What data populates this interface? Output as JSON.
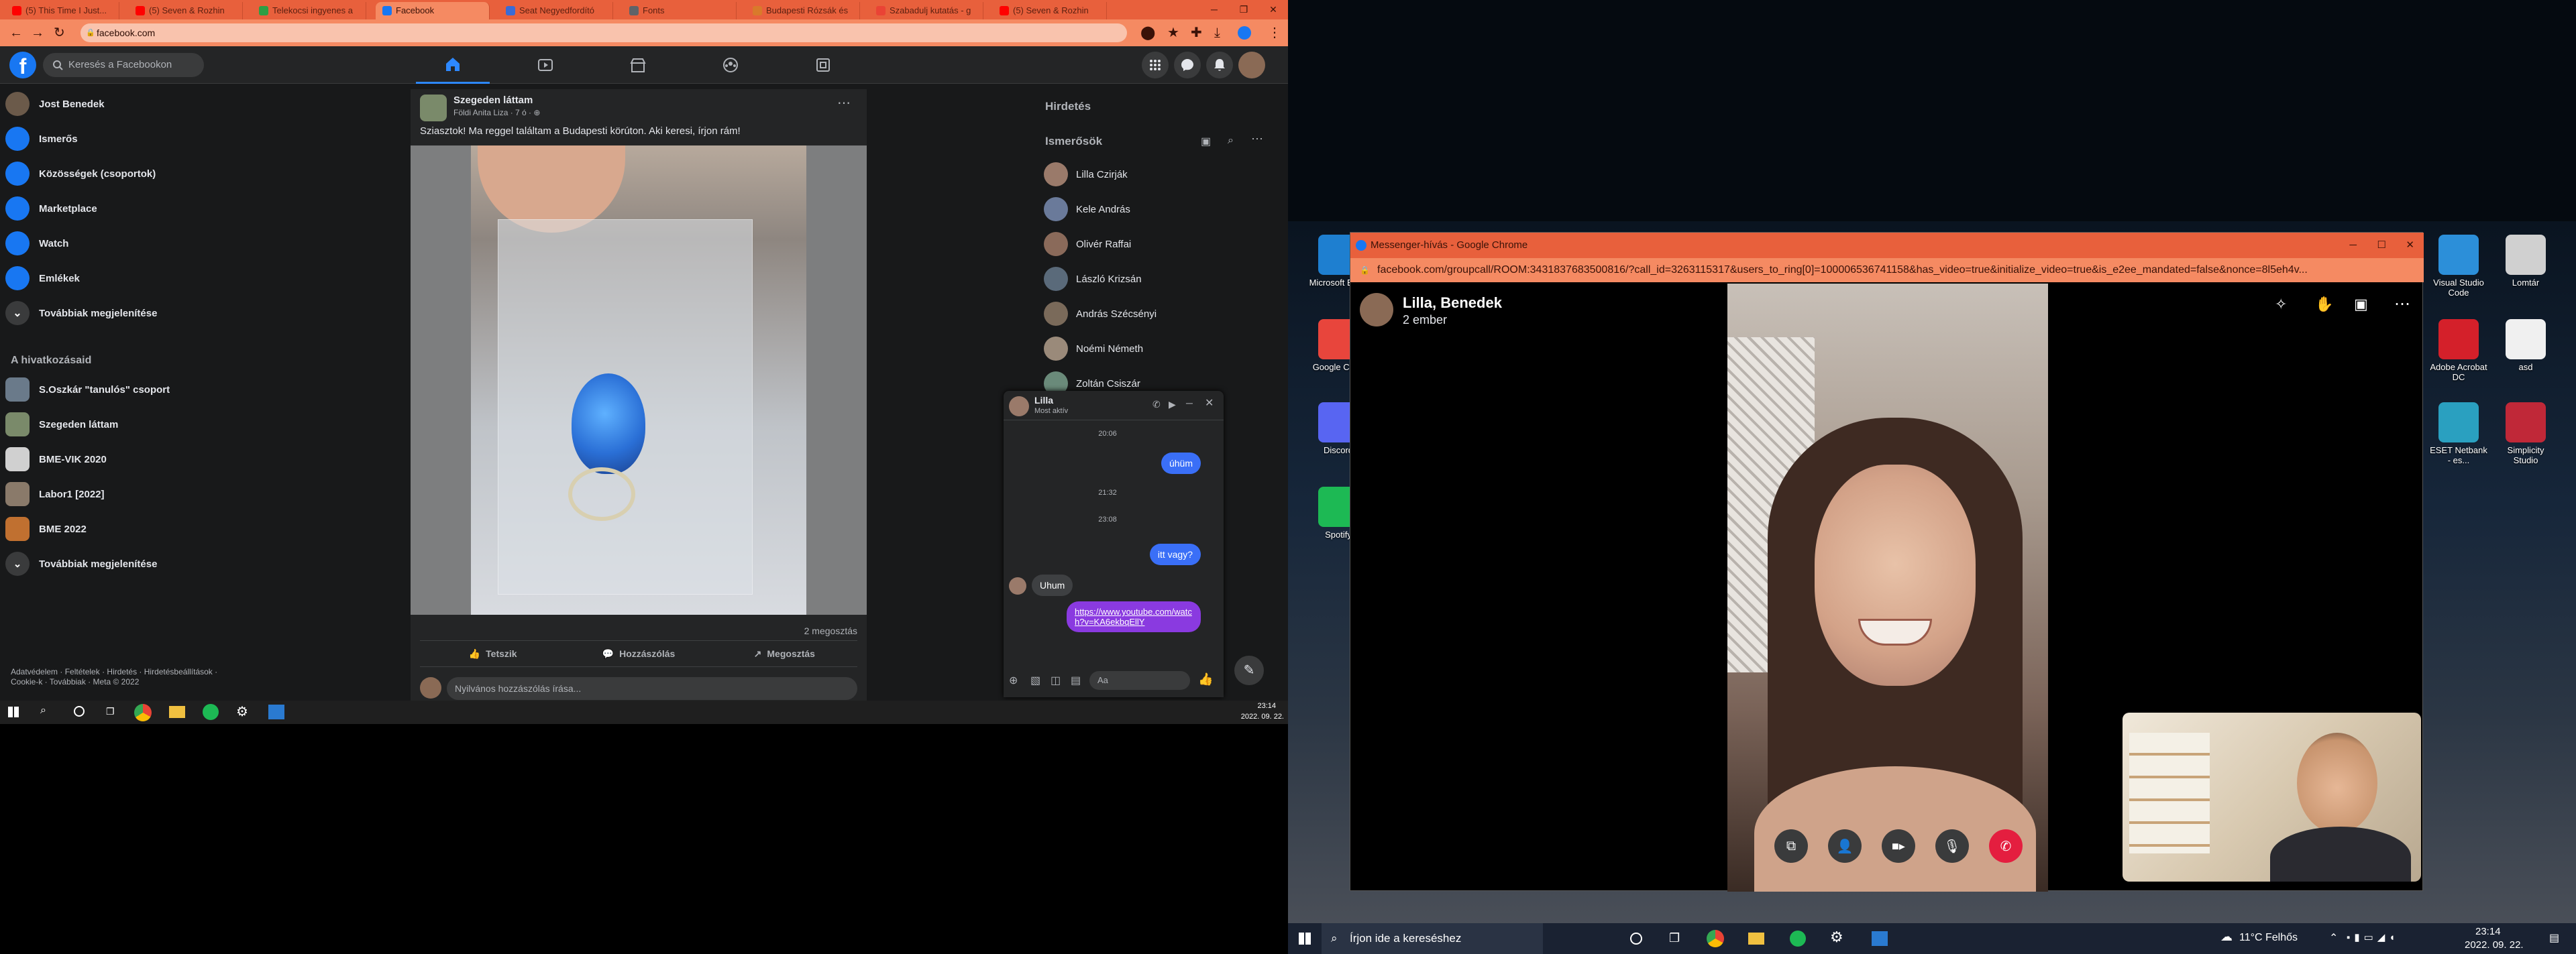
{
  "browser": {
    "tabs": [
      {
        "label": "(5) This Time I Just...",
        "color": "#ff0000"
      },
      {
        "label": "(5) Seven & Rozhin",
        "color": "#ff0000"
      },
      {
        "label": "Telekocsi ingyenes a",
        "color": "#2e9e44"
      },
      {
        "label": "Facebook",
        "color": "#1877f2"
      },
      {
        "label": "Seat Negyedfordító",
        "color": "#3a6bd6"
      },
      {
        "label": "Fonts",
        "color": "#5f6368"
      },
      {
        "label": "Budapesti Rózsák és",
        "color": "#d97a2b"
      },
      {
        "label": "Szabadulj kutatás - g",
        "color": "#ea4335"
      },
      {
        "label": "(5) Seven & Rozhin",
        "color": "#ff0000"
      }
    ],
    "url": "facebook.com"
  },
  "fb": {
    "search_placeholder": "Keresés a Facebookon",
    "nav": [
      {
        "label": "Jost Benedek",
        "icon": "avatar",
        "color": "#6b5a4a"
      },
      {
        "label": "Ismerős",
        "icon": "friends-icon",
        "color": "#1877f2"
      },
      {
        "label": "Közösségek (csoportok)",
        "icon": "groups-icon",
        "color": "#1877f2"
      },
      {
        "label": "Marketplace",
        "icon": "marketplace-icon",
        "color": "#1877f2"
      },
      {
        "label": "Watch",
        "icon": "watch-icon",
        "color": "#1877f2"
      },
      {
        "label": "Emlékek",
        "icon": "memories-icon",
        "color": "#1877f2"
      },
      {
        "label": "Továbbiak megjelenítése",
        "icon": "chevron-down-icon",
        "color": "#3a3b3c"
      }
    ],
    "shortcuts_title": "A hivatkozásaid",
    "shortcuts": [
      {
        "label": "S.Oszkár \"tanulós\" csoport",
        "color": "#6a7a8a"
      },
      {
        "label": "Szegeden láttam",
        "color": "#7a8a6a"
      },
      {
        "label": "BME-VIK 2020",
        "color": "#d0d0d0"
      },
      {
        "label": "Labor1 [2022]",
        "color": "#8a7a6a"
      },
      {
        "label": "BME 2022",
        "color": "#c07030"
      },
      {
        "label": "Továbbiak megjelenítése",
        "color": "#3a3b3c"
      }
    ],
    "footer": "Adatvédelem · Feltételek · Hirdetés · Hirdetésbeállítások · Cookie-k · Továbbiak · Meta © 2022",
    "post": {
      "group": "Szegeden láttam",
      "meta": "Földi Anita Liza · 7 ó · ⊕",
      "text": "Sziasztok! Ma reggel találtam a Budapesti körúton. Aki keresi, írjon rám!",
      "shares": "2 megosztás",
      "like": "Tetszik",
      "comment": "Hozzászólás",
      "share": "Megosztás",
      "comment_placeholder": "Nyilvános hozzászólás írása..."
    },
    "right": {
      "ads_title": "Hirdetés",
      "contacts_title": "Ismerősök",
      "contacts": [
        "Lilla Czirják",
        "Kele András",
        "Olivér Raffai",
        "László Krizsán",
        "András Szécsényi",
        "Noémi Németh",
        "Zoltán Csiszár"
      ],
      "contact_colors": [
        "#9a7a6a",
        "#6a7a9a",
        "#8a6a5a",
        "#5a6a7a",
        "#7a6a5a",
        "#9a8a7a",
        "#6a8a7a"
      ]
    },
    "chat": {
      "name": "Lilla",
      "status": "Most aktív",
      "messages": [
        {
          "type": "time",
          "text": "20:06"
        },
        {
          "type": "out",
          "text": "úhüm"
        },
        {
          "type": "time",
          "text": "21:32"
        },
        {
          "type": "time",
          "text": "23:08"
        },
        {
          "type": "out",
          "text": "itt vagy?"
        },
        {
          "type": "in",
          "text": "Uhum"
        },
        {
          "type": "out",
          "text": "https://www.youtube.com/watch?v=KA6ekbqEllY"
        }
      ],
      "input_placeholder": "Aa"
    }
  },
  "taskbar1": {
    "time": "23:14",
    "date": "2022. 09. 22."
  },
  "messenger_window": {
    "title": "Messenger-hívás - Google Chrome",
    "url": "facebook.com/groupcall/ROOM:3431837683500816/?call_id=3263115317&users_to_ring[0]=100006536741158&has_video=true&initialize_video=true&is_e2ee_mandated=false&nonce=8l5eh4v...",
    "call_name": "Lilla, Benedek",
    "call_people": "2 ember"
  },
  "desktop_icons": [
    {
      "label": "Microsoft Edge",
      "color": "#1e7fd0"
    },
    {
      "label": "Google Chr...",
      "color": "#e8453c"
    },
    {
      "label": "Discord",
      "color": "#5865f2"
    },
    {
      "label": "Spotify",
      "color": "#1db954"
    },
    {
      "label": "Visual Studio Code",
      "color": "#2c8fd9"
    },
    {
      "label": "Lomtár",
      "color": "#d0d0d0"
    },
    {
      "label": "Adobe Acrobat DC",
      "color": "#d4202a"
    },
    {
      "label": "asd",
      "color": "#f0f0f0"
    },
    {
      "label": "ESET Netbank - es...",
      "color": "#2aa0c0"
    },
    {
      "label": "Simplicity Studio",
      "color": "#c02838"
    }
  ],
  "taskbar2": {
    "search_placeholder": "Írjon ide a kereséshez",
    "weather": "11°C Felhős",
    "time": "23:14",
    "date": "2022. 09. 22."
  }
}
